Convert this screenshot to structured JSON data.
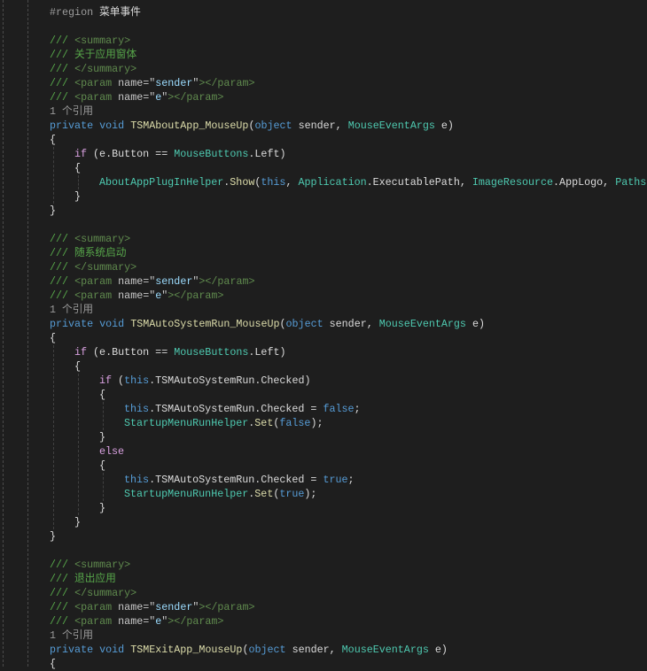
{
  "editor": {
    "lines": [
      {
        "indent": 0,
        "tokens": [
          [
            "pre",
            "#region "
          ],
          [
            "pl",
            "菜单事件"
          ]
        ]
      },
      {
        "indent": 0,
        "tokens": []
      },
      {
        "indent": 0,
        "tokens": [
          [
            "cm",
            "/// "
          ],
          [
            "xt",
            "<summary>"
          ]
        ]
      },
      {
        "indent": 0,
        "tokens": [
          [
            "cm",
            "/// 关于应用窗体"
          ]
        ]
      },
      {
        "indent": 0,
        "tokens": [
          [
            "cm",
            "/// "
          ],
          [
            "xt",
            "</summary>"
          ]
        ]
      },
      {
        "indent": 0,
        "tokens": [
          [
            "cm",
            "/// "
          ],
          [
            "xt",
            "<param "
          ],
          [
            "xa",
            "name=\""
          ],
          [
            "xv",
            "sender"
          ],
          [
            "xa",
            "\""
          ],
          [
            "xt",
            "></param>"
          ]
        ]
      },
      {
        "indent": 0,
        "tokens": [
          [
            "cm",
            "/// "
          ],
          [
            "xt",
            "<param "
          ],
          [
            "xa",
            "name=\""
          ],
          [
            "xv",
            "e"
          ],
          [
            "xa",
            "\""
          ],
          [
            "xt",
            "></param>"
          ]
        ]
      },
      {
        "indent": 0,
        "tokens": [
          [
            "ref",
            "1 个引用"
          ]
        ]
      },
      {
        "indent": 0,
        "tokens": [
          [
            "kw",
            "private void "
          ],
          [
            "fn",
            "TSMAboutApp_MouseUp"
          ],
          [
            "pl",
            "("
          ],
          [
            "kw",
            "object "
          ],
          [
            "pl",
            "sender, "
          ],
          [
            "type",
            "MouseEventArgs "
          ],
          [
            "pl",
            "e)"
          ]
        ]
      },
      {
        "indent": 0,
        "tokens": [
          [
            "pl",
            "{"
          ]
        ]
      },
      {
        "indent": 1,
        "tokens": [
          [
            "ctl",
            "if "
          ],
          [
            "pl",
            "(e.Button == "
          ],
          [
            "type",
            "MouseButtons"
          ],
          [
            "pl",
            ".Left)"
          ]
        ]
      },
      {
        "indent": 1,
        "tokens": [
          [
            "pl",
            "{"
          ]
        ]
      },
      {
        "indent": 2,
        "tokens": [
          [
            "type",
            "AboutAppPlugInHelper"
          ],
          [
            "pl",
            "."
          ],
          [
            "fn",
            "Show"
          ],
          [
            "pl",
            "("
          ],
          [
            "kw",
            "this"
          ],
          [
            "pl",
            ", "
          ],
          [
            "type",
            "Application"
          ],
          [
            "pl",
            ".ExecutablePath, "
          ],
          [
            "type",
            "ImageResource"
          ],
          [
            "pl",
            ".AppLogo, "
          ],
          [
            "type",
            "Paths"
          ],
          [
            "pl",
            "."
          ]
        ]
      },
      {
        "indent": 1,
        "tokens": [
          [
            "pl",
            "}"
          ]
        ]
      },
      {
        "indent": 0,
        "tokens": [
          [
            "pl",
            "}"
          ]
        ]
      },
      {
        "indent": 0,
        "tokens": []
      },
      {
        "indent": 0,
        "tokens": [
          [
            "cm",
            "/// "
          ],
          [
            "xt",
            "<summary>"
          ]
        ]
      },
      {
        "indent": 0,
        "tokens": [
          [
            "cm",
            "/// 随系统启动"
          ]
        ]
      },
      {
        "indent": 0,
        "tokens": [
          [
            "cm",
            "/// "
          ],
          [
            "xt",
            "</summary>"
          ]
        ]
      },
      {
        "indent": 0,
        "tokens": [
          [
            "cm",
            "/// "
          ],
          [
            "xt",
            "<param "
          ],
          [
            "xa",
            "name=\""
          ],
          [
            "xv",
            "sender"
          ],
          [
            "xa",
            "\""
          ],
          [
            "xt",
            "></param>"
          ]
        ]
      },
      {
        "indent": 0,
        "tokens": [
          [
            "cm",
            "/// "
          ],
          [
            "xt",
            "<param "
          ],
          [
            "xa",
            "name=\""
          ],
          [
            "xv",
            "e"
          ],
          [
            "xa",
            "\""
          ],
          [
            "xt",
            "></param>"
          ]
        ]
      },
      {
        "indent": 0,
        "tokens": [
          [
            "ref",
            "1 个引用"
          ]
        ]
      },
      {
        "indent": 0,
        "tokens": [
          [
            "kw",
            "private void "
          ],
          [
            "fn",
            "TSMAutoSystemRun_MouseUp"
          ],
          [
            "pl",
            "("
          ],
          [
            "kw",
            "object "
          ],
          [
            "pl",
            "sender, "
          ],
          [
            "type",
            "MouseEventArgs "
          ],
          [
            "pl",
            "e)"
          ]
        ]
      },
      {
        "indent": 0,
        "tokens": [
          [
            "pl",
            "{"
          ]
        ]
      },
      {
        "indent": 1,
        "tokens": [
          [
            "ctl",
            "if "
          ],
          [
            "pl",
            "(e.Button == "
          ],
          [
            "type",
            "MouseButtons"
          ],
          [
            "pl",
            ".Left)"
          ]
        ]
      },
      {
        "indent": 1,
        "tokens": [
          [
            "pl",
            "{"
          ]
        ]
      },
      {
        "indent": 2,
        "tokens": [
          [
            "ctl",
            "if "
          ],
          [
            "pl",
            "("
          ],
          [
            "kw",
            "this"
          ],
          [
            "pl",
            ".TSMAutoSystemRun.Checked)"
          ]
        ]
      },
      {
        "indent": 2,
        "tokens": [
          [
            "pl",
            "{"
          ]
        ]
      },
      {
        "indent": 3,
        "tokens": [
          [
            "kw",
            "this"
          ],
          [
            "pl",
            ".TSMAutoSystemRun.Checked = "
          ],
          [
            "kw",
            "false"
          ],
          [
            "pl",
            ";"
          ]
        ]
      },
      {
        "indent": 3,
        "tokens": [
          [
            "type",
            "StartupMenuRunHelper"
          ],
          [
            "pl",
            "."
          ],
          [
            "fn",
            "Set"
          ],
          [
            "pl",
            "("
          ],
          [
            "kw",
            "false"
          ],
          [
            "pl",
            ");"
          ]
        ]
      },
      {
        "indent": 2,
        "tokens": [
          [
            "pl",
            "}"
          ]
        ]
      },
      {
        "indent": 2,
        "tokens": [
          [
            "ctl",
            "else"
          ]
        ]
      },
      {
        "indent": 2,
        "tokens": [
          [
            "pl",
            "{"
          ]
        ]
      },
      {
        "indent": 3,
        "tokens": [
          [
            "kw",
            "this"
          ],
          [
            "pl",
            ".TSMAutoSystemRun.Checked = "
          ],
          [
            "kw",
            "true"
          ],
          [
            "pl",
            ";"
          ]
        ]
      },
      {
        "indent": 3,
        "tokens": [
          [
            "type",
            "StartupMenuRunHelper"
          ],
          [
            "pl",
            "."
          ],
          [
            "fn",
            "Set"
          ],
          [
            "pl",
            "("
          ],
          [
            "kw",
            "true"
          ],
          [
            "pl",
            ");"
          ]
        ]
      },
      {
        "indent": 2,
        "tokens": [
          [
            "pl",
            "}"
          ]
        ]
      },
      {
        "indent": 1,
        "tokens": [
          [
            "pl",
            "}"
          ]
        ]
      },
      {
        "indent": 0,
        "tokens": [
          [
            "pl",
            "}"
          ]
        ]
      },
      {
        "indent": 0,
        "tokens": []
      },
      {
        "indent": 0,
        "tokens": [
          [
            "cm",
            "/// "
          ],
          [
            "xt",
            "<summary>"
          ]
        ]
      },
      {
        "indent": 0,
        "tokens": [
          [
            "cm",
            "/// 退出应用"
          ]
        ]
      },
      {
        "indent": 0,
        "tokens": [
          [
            "cm",
            "/// "
          ],
          [
            "xt",
            "</summary>"
          ]
        ]
      },
      {
        "indent": 0,
        "tokens": [
          [
            "cm",
            "/// "
          ],
          [
            "xt",
            "<param "
          ],
          [
            "xa",
            "name=\""
          ],
          [
            "xv",
            "sender"
          ],
          [
            "xa",
            "\""
          ],
          [
            "xt",
            "></param>"
          ]
        ]
      },
      {
        "indent": 0,
        "tokens": [
          [
            "cm",
            "/// "
          ],
          [
            "xt",
            "<param "
          ],
          [
            "xa",
            "name=\""
          ],
          [
            "xv",
            "e"
          ],
          [
            "xa",
            "\""
          ],
          [
            "xt",
            "></param>"
          ]
        ]
      },
      {
        "indent": 0,
        "tokens": [
          [
            "ref",
            "1 个引用"
          ]
        ]
      },
      {
        "indent": 0,
        "tokens": [
          [
            "kw",
            "private void "
          ],
          [
            "fn",
            "TSMExitApp_MouseUp"
          ],
          [
            "pl",
            "("
          ],
          [
            "kw",
            "object "
          ],
          [
            "pl",
            "sender, "
          ],
          [
            "type",
            "MouseEventArgs "
          ],
          [
            "pl",
            "e)"
          ]
        ]
      },
      {
        "indent": 0,
        "tokens": [
          [
            "pl",
            "{"
          ]
        ]
      }
    ]
  }
}
